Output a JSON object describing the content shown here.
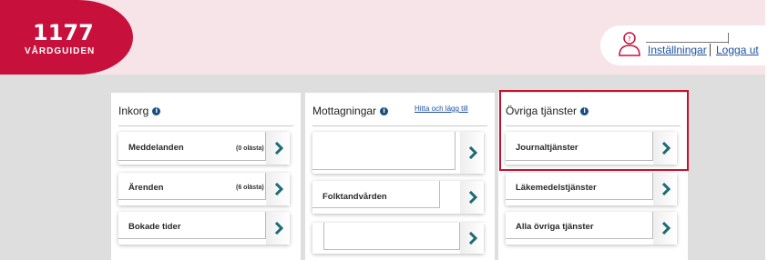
{
  "brand": {
    "name": "1177",
    "tagline": "VÅRDGUIDEN",
    "color": "#c8103c"
  },
  "header": {
    "user_icon": "user-icon",
    "settings_label": "Inställningar",
    "logout_label": "Logga ut",
    "link_color": "#1e50a0"
  },
  "inbox": {
    "title": "Inkorg",
    "items": [
      {
        "label": "Meddelanden",
        "count": "(0 olästa)"
      },
      {
        "label": "Ärenden",
        "count": "(6 olästa)"
      },
      {
        "label": "Bokade tider"
      }
    ]
  },
  "clinics": {
    "title": "Mottagningar",
    "link": "Hitta och lägg till",
    "items": [
      {
        "label": ""
      },
      {
        "label": "Folktandvården"
      },
      {
        "label": ""
      }
    ]
  },
  "other": {
    "title": "Övriga tjänster",
    "items": [
      {
        "label": "Journaltjänster"
      },
      {
        "label": "Läkemedelstjänster"
      },
      {
        "label": "Alla övriga tjänster"
      }
    ]
  },
  "colors": {
    "chevron": "#1a6b75",
    "highlight": "#c8102e",
    "info_icon": "#1a4c84"
  }
}
